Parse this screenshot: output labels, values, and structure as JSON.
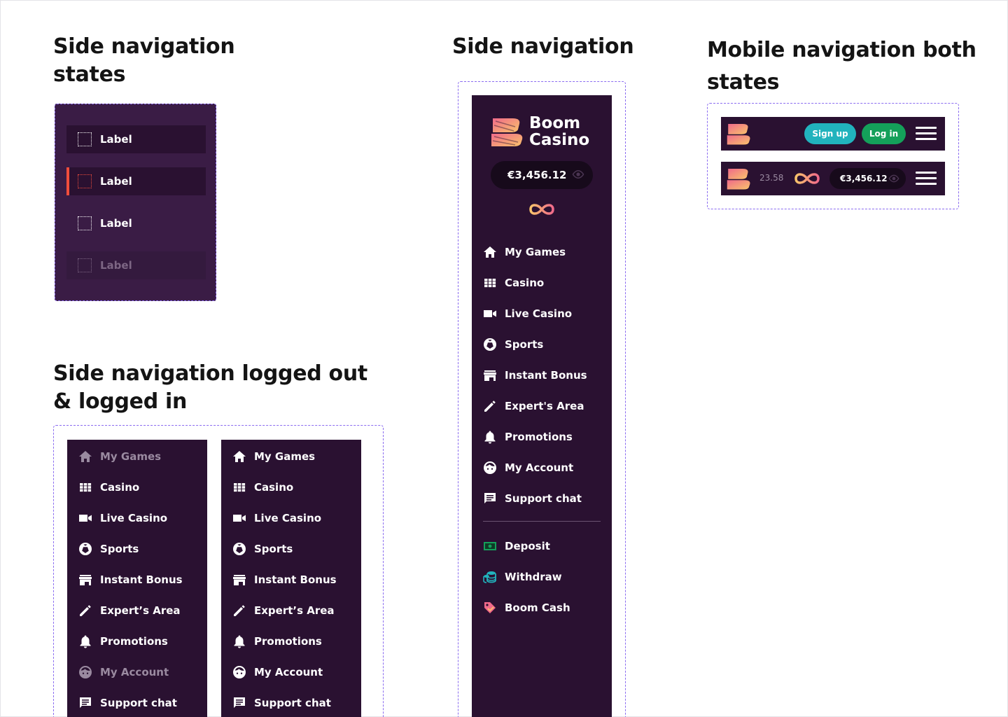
{
  "headings": {
    "states": "Side navigation states",
    "logged": "Side navigation logged out & logged in",
    "side": "Side navigation",
    "mobile": "Mobile navigation both states"
  },
  "states": [
    "Label",
    "Label",
    "Label",
    "Label"
  ],
  "brand": {
    "line1": "Boom",
    "line2": "Casino"
  },
  "balance": "€3,456.12",
  "menu": [
    "My Games",
    "Casino",
    "Live Casino",
    "Sports",
    "Instant Bonus",
    "Expert's Area",
    "Promotions",
    "My Account",
    "Support chat"
  ],
  "menu_logged": [
    "My Games",
    "Casino",
    "Live Casino",
    "Sports",
    "Instant Bonus",
    "Expert’s Area",
    "Promotions",
    "My Account",
    "Support chat"
  ],
  "wallet": [
    "Deposit",
    "Withdraw",
    "Boom Cash"
  ],
  "mobile": {
    "signup": "Sign up",
    "login": "Log in",
    "points": "23.58",
    "balance": "€3,456.12"
  },
  "colors": {
    "panel": "#2a1131",
    "accent_red": "#f04d3c",
    "signup": "#21b3bd",
    "login": "#14a05a",
    "dashed": "#8b6cf0"
  }
}
